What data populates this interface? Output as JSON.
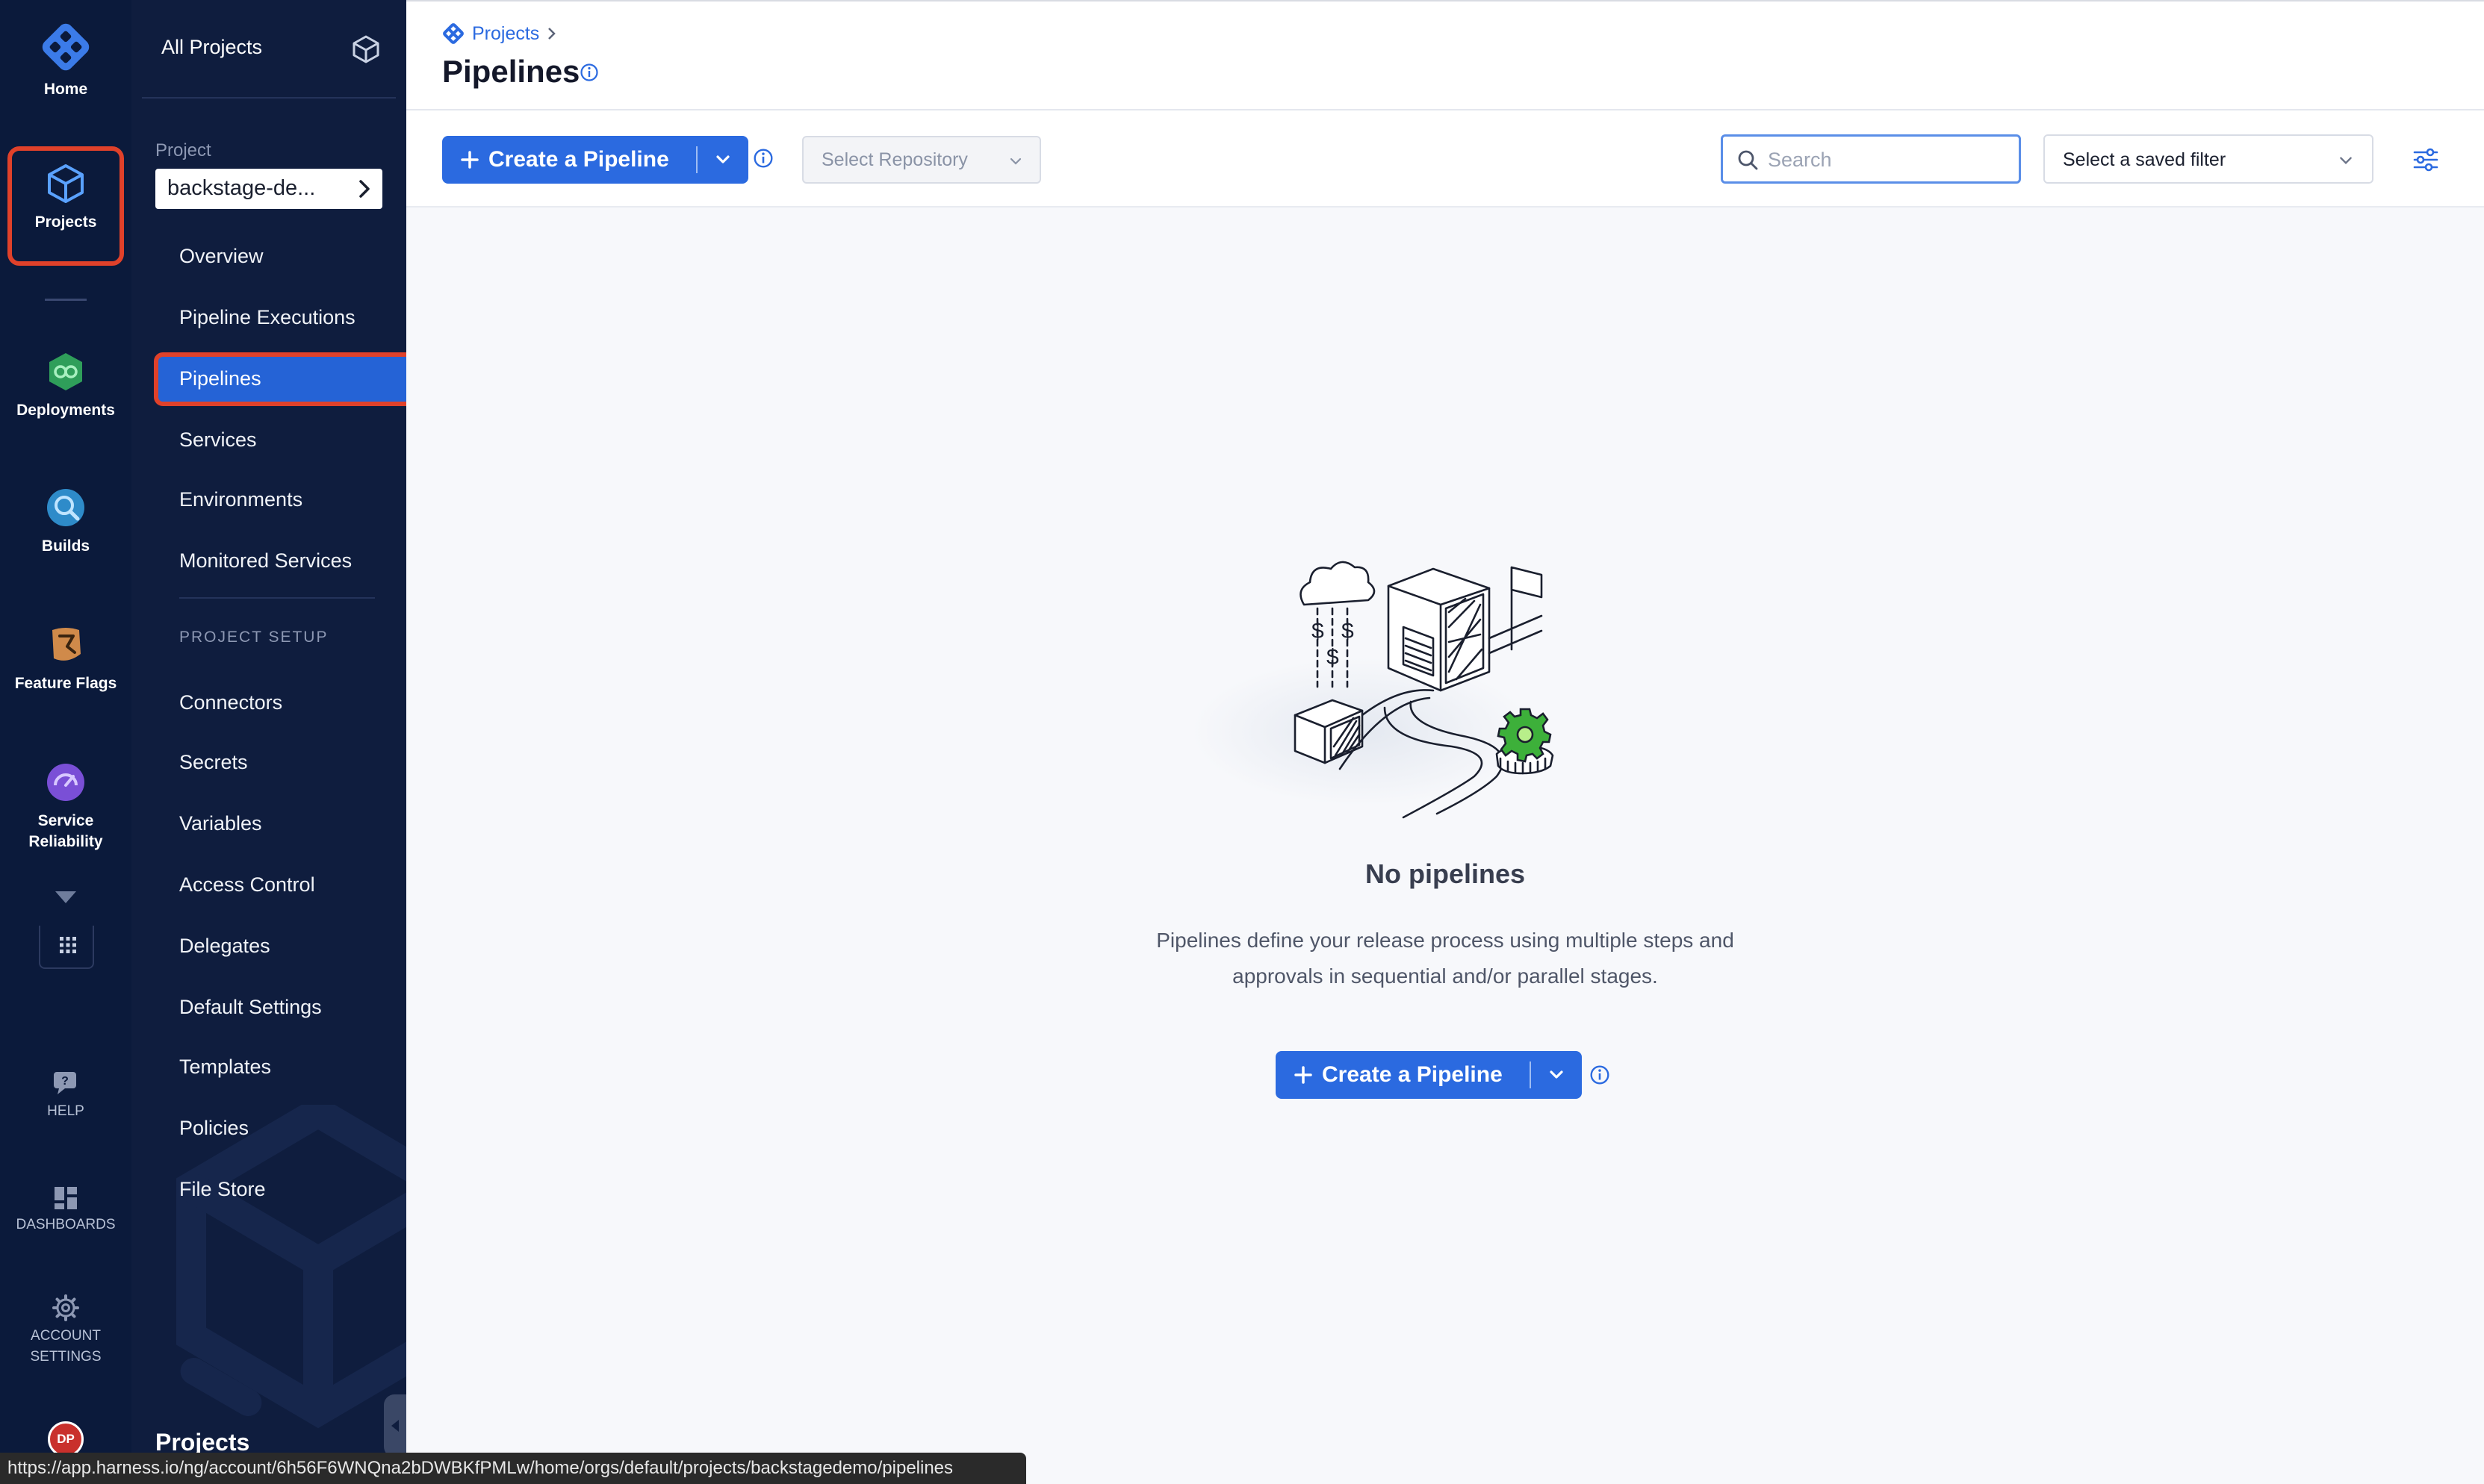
{
  "nav": {
    "home_label": "Home",
    "projects_label": "Projects",
    "deployments_label": "Deployments",
    "builds_label": "Builds",
    "feature_flags_label": "Feature Flags",
    "service_reliability_label_1": "Service",
    "service_reliability_label_2": "Reliability",
    "help_label": "HELP",
    "dashboards_label": "DASHBOARDS",
    "account_settings_label_1": "ACCOUNT",
    "account_settings_label_2": "SETTINGS",
    "avatar_initials": "DP"
  },
  "sidebar": {
    "all_projects": "All Projects",
    "project_caption": "Project",
    "project_name": "backstage-de...",
    "items": [
      {
        "label": "Overview"
      },
      {
        "label": "Pipeline Executions"
      },
      {
        "label": "Pipelines"
      },
      {
        "label": "Services"
      },
      {
        "label": "Environments"
      },
      {
        "label": "Monitored Services"
      }
    ],
    "setup_heading": "PROJECT SETUP",
    "setup_items": [
      {
        "label": "Connectors"
      },
      {
        "label": "Secrets"
      },
      {
        "label": "Variables"
      },
      {
        "label": "Access Control"
      },
      {
        "label": "Delegates"
      },
      {
        "label": "Default Settings"
      },
      {
        "label": "Templates"
      },
      {
        "label": "Policies"
      },
      {
        "label": "File Store"
      }
    ],
    "footer_title": "Projects"
  },
  "header": {
    "breadcrumb": "Projects",
    "title": "Pipelines"
  },
  "toolbar": {
    "create_label": "Create a Pipeline",
    "repo_placeholder": "Select Repository",
    "search_placeholder": "Search",
    "saved_filter": "Select a saved filter"
  },
  "empty": {
    "title": "No pipelines",
    "desc_1": "Pipelines define your release process using multiple steps and",
    "desc_2": "approvals in sequential and/or parallel stages.",
    "create_label": "Create a Pipeline"
  },
  "status_url": "https://app.harness.io/ng/account/6h56F6WNQna2bDWBKfPMLw/home/orgs/default/projects/backstagedemo/pipelines",
  "colors": {
    "nav_bg": "#0b1a3b",
    "sidebar_bg": "#0f1d3e",
    "accent": "#2b6ae0",
    "highlight_outline": "#e0412a"
  }
}
